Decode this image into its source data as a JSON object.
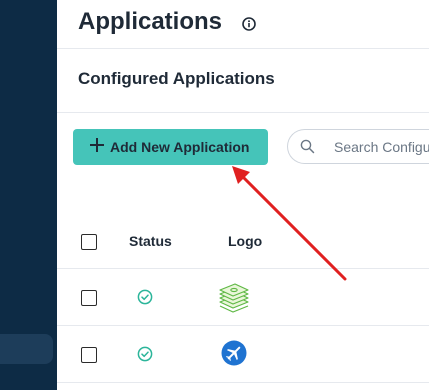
{
  "header": {
    "title": "Applications",
    "info_icon": "info-icon"
  },
  "section": {
    "title": "Configured Applications"
  },
  "toolbar": {
    "add_label": "Add New Application",
    "add_icon": "plus-icon",
    "search": {
      "placeholder": "Search Configured Applications",
      "value": ""
    }
  },
  "table": {
    "columns": [
      "Status",
      "Logo"
    ],
    "rows": [
      {
        "status": "active",
        "status_icon": "check-circle-icon",
        "logo_icon": "money-stack-logo-icon",
        "selected": false
      },
      {
        "status": "active",
        "status_icon": "check-circle-icon",
        "logo_icon": "airplane-logo-icon",
        "selected": false
      }
    ]
  },
  "colors": {
    "sidebar": "#0d2b45",
    "accent": "#45c4b9",
    "status_ok": "#2bb59a",
    "annotation_arrow": "#e02020"
  },
  "annotation": {
    "type": "arrow",
    "target": "add-new-application-button"
  }
}
